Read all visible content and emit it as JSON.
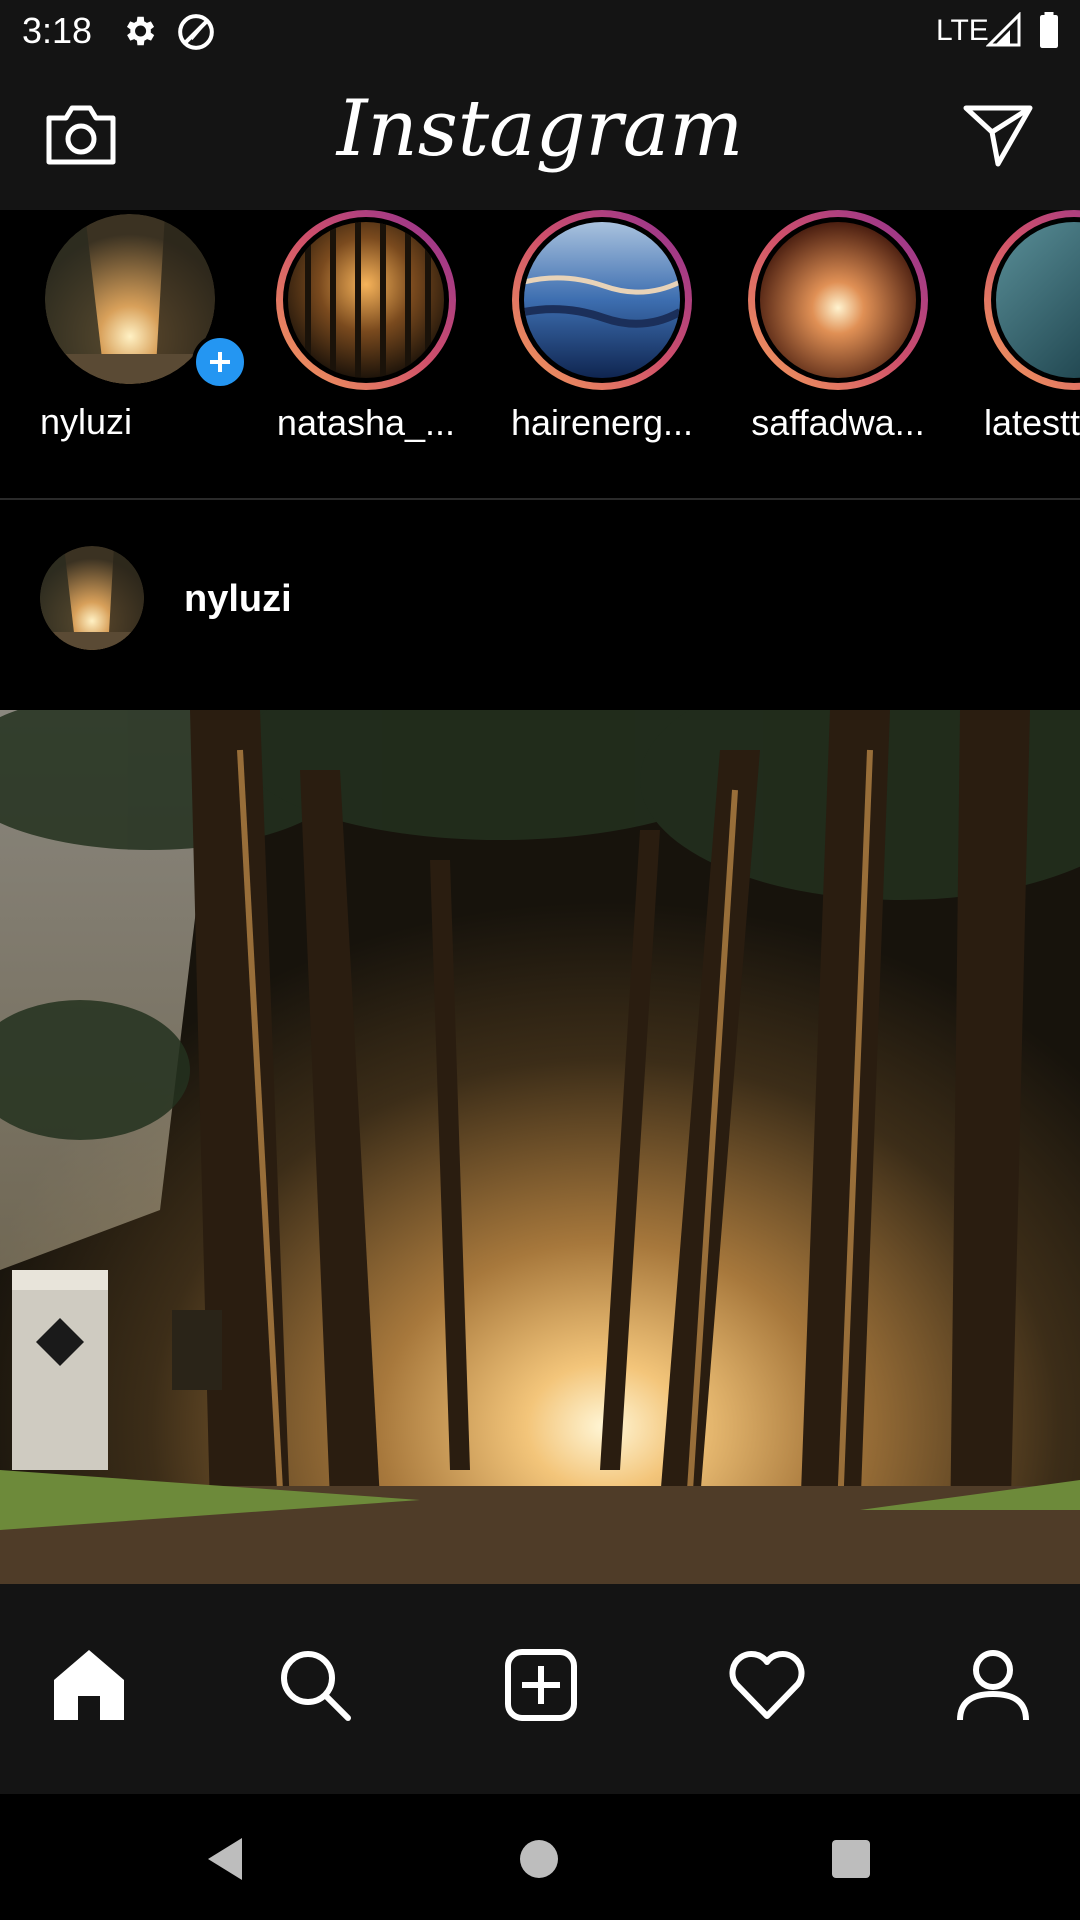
{
  "status_bar": {
    "time": "3:18",
    "network": "LTE",
    "icons": [
      "gear-icon",
      "do-not-disturb-icon",
      "signal-icon",
      "battery-icon"
    ]
  },
  "app_bar": {
    "title": "Instagram",
    "left_icon": "camera-icon",
    "right_icon": "send-icon"
  },
  "stories": [
    {
      "label": "nyluzi",
      "own": true
    },
    {
      "label": "natasha_..."
    },
    {
      "label": "hairenerg..."
    },
    {
      "label": "saffadwa..."
    },
    {
      "label": "latestt"
    }
  ],
  "post": {
    "username": "nyluzi"
  },
  "bottom_nav": [
    "home-icon",
    "search-icon",
    "add-post-icon",
    "heart-icon",
    "profile-icon"
  ],
  "system_nav": [
    "back-icon",
    "home-circle-icon",
    "recents-icon"
  ],
  "colors": {
    "bar_bg": "#141414",
    "story_ring_start": "#f5a15b",
    "story_ring_end": "#8e2f94",
    "add_badge": "#2496f2"
  }
}
